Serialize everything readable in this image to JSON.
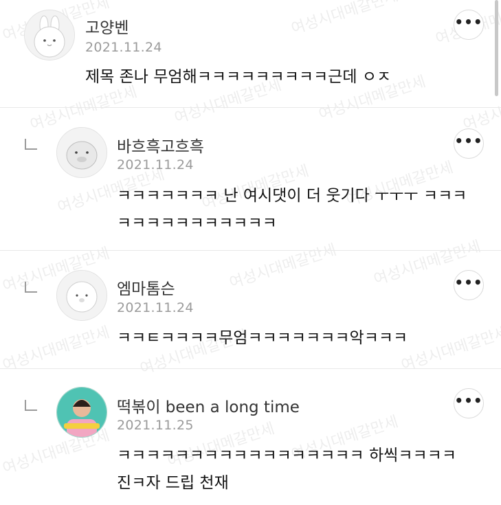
{
  "watermark_text": "여성시대메갈만세",
  "more_button_label": "•••",
  "comments": [
    {
      "author": "고양벤",
      "date": "2021.11.24",
      "text": "제목 존나 무엄해ㅋㅋㅋㅋㅋㅋㅋㅋㅋ근데 ㅇㅈ",
      "reply": false
    },
    {
      "author": "바흐흑고흐흑",
      "date": "2021.11.24",
      "text": "ㅋㅋㅋㅋㅋㅋㅋ 난 여시댓이 더 웃기다 ㅜㅜㅜ ㅋㅋㅋㅋㅋㅋㅋㅋㅋㅋㅋㅋㅋㅋ",
      "reply": true
    },
    {
      "author": "엠마톰슨",
      "date": "2021.11.24",
      "text": "ㅋㅋㅌㅋㅋㅋㅋ무엄ㅋㅋㅋㅋㅋㅋㅋ악ㅋㅋㅋ",
      "reply": true
    },
    {
      "author": "떡볶이 been a long time",
      "date": "2021.11.25",
      "text": "ㅋㅋㅋㅋㅋㅋㅋㅋㅋㅋㅋㅋㅋㅋㅋㅋㅋ 하씩ㅋㅋㅋㅋ 진ㅋ자 드립 천재",
      "reply": true
    }
  ]
}
